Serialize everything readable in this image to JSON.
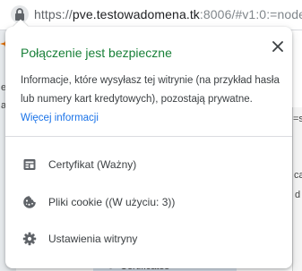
{
  "address_bar": {
    "url_scheme": "https://",
    "url_host": "pve.testowadomena.tk",
    "url_rest": ":8006/#v1:0:=node"
  },
  "background_page": {
    "fragments": [
      "e",
      "a",
      "=s",
      "ca",
      "d"
    ],
    "tab_label": "Certificates"
  },
  "popup": {
    "title": "Połączenie jest bezpieczne",
    "description": "Informacje, które wysyłasz tej witrynie (na przykład hasła lub numery kart kredytowych), pozostają prywatne.",
    "more_info_link": "Więcej informacji",
    "items": [
      {
        "label": "Certyfikat (Ważny)",
        "icon": "certificate-icon"
      },
      {
        "label": "Pliki cookie ((W użyciu: 3))",
        "icon": "cookie-icon"
      },
      {
        "label": "Ustawienia witryny",
        "icon": "gear-icon"
      }
    ]
  },
  "colors": {
    "secure_title": "#188038",
    "link": "#1a73e8",
    "icon": "#5f6368"
  }
}
